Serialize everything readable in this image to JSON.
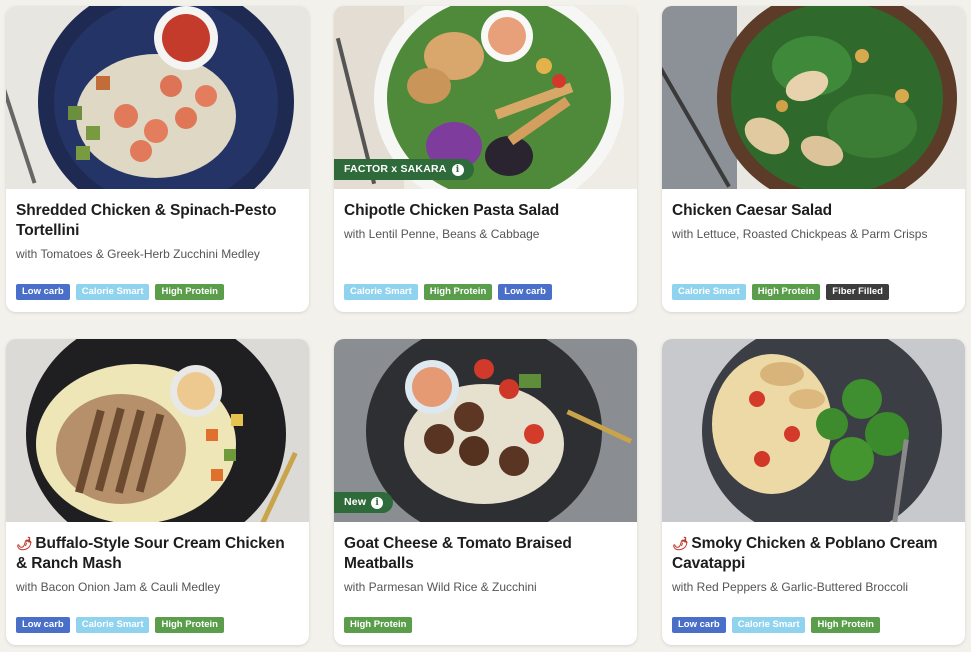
{
  "colors": {
    "low_carb": "#4a6fc9",
    "calorie_smart": "#8fd3ee",
    "high_protein": "#5a9e4b",
    "fiber_filled": "#3d3d3d",
    "tag_green": "#2f6b3a"
  },
  "meals": [
    {
      "title": "Shredded Chicken & Spinach-Pesto Tortellini",
      "spicy": false,
      "subtitle": "with Tomatoes & Greek-Herb Zucchini Medley",
      "tag": null,
      "badges": [
        "Low carb",
        "Calorie Smart",
        "High Protein"
      ]
    },
    {
      "title": "Chipotle Chicken Pasta Salad",
      "spicy": false,
      "subtitle": "with Lentil Penne, Beans & Cabbage",
      "tag": "FACTOR x SAKARA",
      "badges": [
        "Calorie Smart",
        "High Protein",
        "Low carb"
      ]
    },
    {
      "title": "Chicken Caesar Salad",
      "spicy": false,
      "subtitle": "with Lettuce, Roasted Chickpeas & Parm Crisps",
      "tag": null,
      "badges": [
        "Calorie Smart",
        "High Protein",
        "Fiber Filled"
      ]
    },
    {
      "title": "Buffalo-Style Sour Cream Chicken & Ranch Mash",
      "spicy": true,
      "subtitle": "with Bacon Onion Jam & Cauli Medley",
      "tag": null,
      "badges": [
        "Low carb",
        "Calorie Smart",
        "High Protein"
      ]
    },
    {
      "title": "Goat Cheese & Tomato Braised Meatballs",
      "spicy": false,
      "subtitle": "with Parmesan Wild Rice & Zucchini",
      "tag": "New",
      "badges": [
        "High Protein"
      ]
    },
    {
      "title": "Smoky Chicken & Poblano Cream Cavatappi",
      "spicy": true,
      "subtitle": "with Red Peppers & Garlic-Buttered Broccoli",
      "tag": null,
      "badges": [
        "Low carb",
        "Calorie Smart",
        "High Protein"
      ]
    }
  ]
}
